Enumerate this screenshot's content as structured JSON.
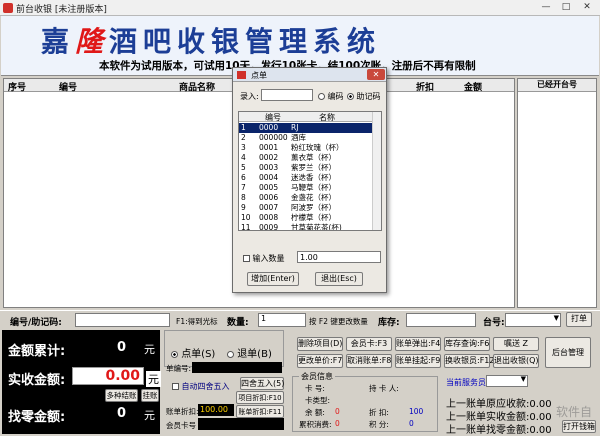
{
  "window": {
    "title": "前台收银 [未注册版本]",
    "minimize": "—",
    "maximize": "□",
    "close": "✕"
  },
  "banner": {
    "title_pre": "嘉",
    "title_red": "隆",
    "title_post": "酒吧收银管理系统",
    "notice": "本软件为试用版本，可试用10天，发行10张卡，结100次账，注册后不再有限制"
  },
  "grid": {
    "headers": [
      "序号",
      "编号",
      "商品名称",
      "折扣",
      "金额"
    ]
  },
  "right_panel": {
    "header": "已经开台号"
  },
  "toolbar": {
    "code_label": "编号/助记码:",
    "hint": "F1:得到光标",
    "qty_label": "数量:",
    "qty_value": "1",
    "hint2": "按 F2 键更改数量",
    "stock_label": "库存:",
    "table_label": "台号:",
    "print_btn": "打单"
  },
  "money": {
    "total_label": "金额累计:",
    "total_value": "0",
    "paid_label": "实收金额:",
    "paid_value": "0.00",
    "change_label": "找零金额:",
    "change_value": "0",
    "yuan": "元",
    "multi_btn": "多种结账",
    "hang_btn": "挂账"
  },
  "order": {
    "order_radio": "点单(S)",
    "return_radio": "退单(B)",
    "round_check": "自动四舍五入",
    "round_btn": "四舍五入(5)",
    "project_btn": "项目折扣:F10",
    "bill_btn": "账单折扣:F11",
    "bill_no_label": "单编号:",
    "bill_disc_label": "账单折扣:",
    "bill_disc_value": "100.00",
    "member_card_label": "会员卡号"
  },
  "buttons": [
    "删除项目(D)",
    "会员卡:F3",
    "账单弹出:F4",
    "库存查询:F6",
    "嘱送 Z",
    "更改单价:F7",
    "取消账单:F8",
    "账单挂起:F9",
    "换收银员:F12",
    "退出收银(Q)",
    "后台管理"
  ],
  "member": {
    "group": "会员信息",
    "card_no": "卡  号:",
    "holder": "持  卡  人:",
    "card_type": "卡类型:",
    "balance": "余  额:",
    "balance_value": "0",
    "discount": "折      扣:",
    "discount_value": "100",
    "points": "累积消费:",
    "points_value": "0",
    "score": "积  分:",
    "score_value": "0"
  },
  "footer": {
    "server_label": "当前服务员",
    "last_orig": "上一账单原应收款:0.00",
    "last_paid": "上一账单实收金额:0.00",
    "last_change": "上一账单找零金额:0.00",
    "open_drawer": "打开钱箱",
    "watermark": "软件自"
  },
  "dialog": {
    "title": "点单",
    "close": "✕",
    "input_label": "录入:",
    "radio_code": "编码",
    "radio_mnemonic": "助记码",
    "col_code": "编号",
    "col_name": "名称",
    "rows": [
      {
        "idx": "1",
        "code": "0000",
        "name": "RJ"
      },
      {
        "idx": "2",
        "code": "000000",
        "name": "酒库"
      },
      {
        "idx": "3",
        "code": "0001",
        "name": "粉红玫瑰（杯）"
      },
      {
        "idx": "4",
        "code": "0002",
        "name": "薰衣草（杯）"
      },
      {
        "idx": "5",
        "code": "0003",
        "name": "紫罗兰（杯）"
      },
      {
        "idx": "6",
        "code": "0004",
        "name": "迷迭香（杯）"
      },
      {
        "idx": "7",
        "code": "0005",
        "name": "马鞭草（杯）"
      },
      {
        "idx": "8",
        "code": "0006",
        "name": "金盏花（杯）"
      },
      {
        "idx": "9",
        "code": "0007",
        "name": "阿波罗（杯）"
      },
      {
        "idx": "10",
        "code": "0008",
        "name": "柠檬草（杯）"
      },
      {
        "idx": "11",
        "code": "0009",
        "name": "甘草菊花茶(杯)"
      }
    ],
    "qty_check": "输入数量",
    "qty_value": "1.00",
    "add_btn": "增加(Enter)",
    "exit_btn": "退出(Esc)"
  }
}
